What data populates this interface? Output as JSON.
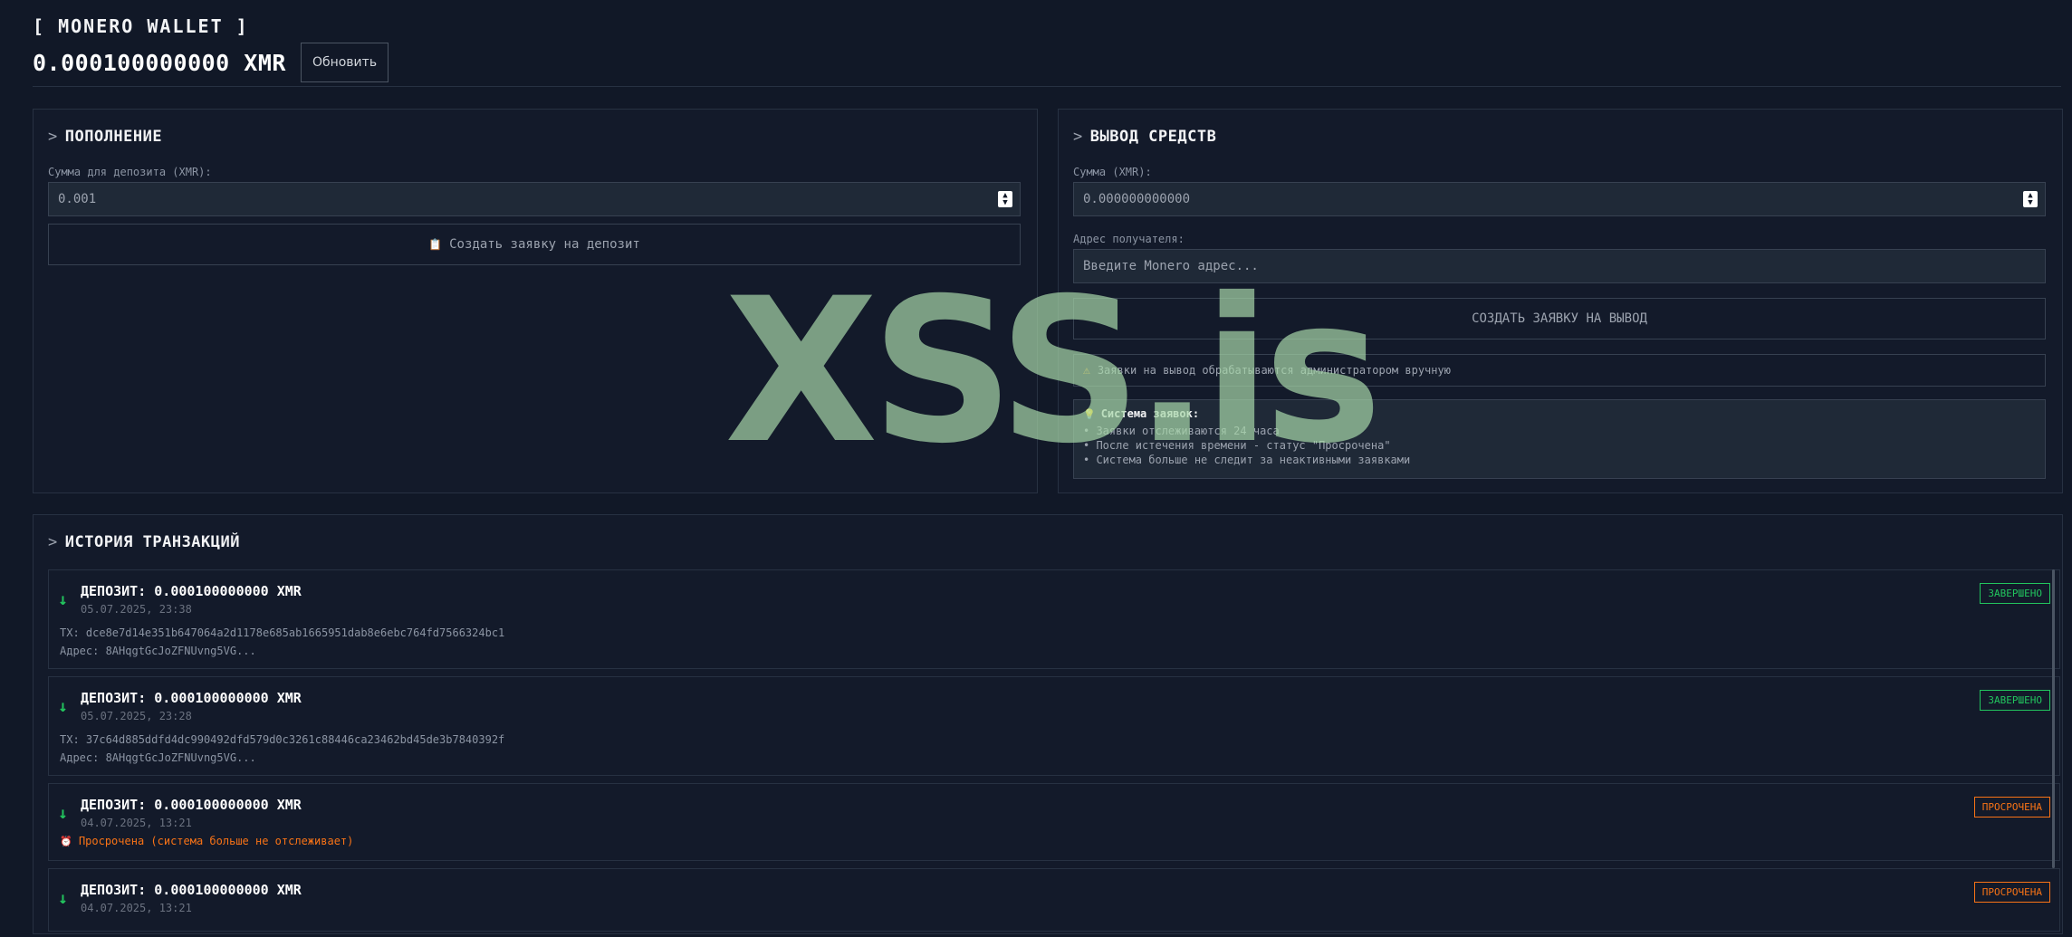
{
  "header": {
    "brand": "[ MONERO WALLET ]",
    "balance": "0.000100000000 XMR",
    "refresh_label": "Обновить"
  },
  "deposit": {
    "title": "ПОПОЛНЕНИЕ",
    "prompt": ">",
    "amount_label": "Сумма для депозита (XMR):",
    "amount_value": "0.001",
    "create_button": "Создать заявку на депозит"
  },
  "withdraw": {
    "title": "ВЫВОД СРЕДСТВ",
    "prompt": ">",
    "amount_label": "Сумма (XMR):",
    "amount_value": "0.000000000000",
    "address_label": "Адрес получателя:",
    "address_placeholder": "Введите Monero адрес...",
    "create_button": "СОЗДАТЬ ЗАЯВКУ НА ВЫВОД",
    "warning": "Заявки на вывод обрабатываются администратором вручную",
    "info_title": "Система заявок:",
    "info_lines": [
      "• Заявки отслеживаются 24 часа",
      "• После истечения времени - статус \"Просрочена\"",
      "• Система больше не следит за неактивными заявками"
    ]
  },
  "history": {
    "title": "ИСТОРИЯ ТРАНЗАКЦИЙ",
    "prompt": ">",
    "transactions": [
      {
        "title": "ДЕПОЗИТ: 0.000100000000 XMR",
        "date": "05.07.2025, 23:38",
        "tx": "TX: dce8e7d14e351b647064a2d1178e685ab1665951dab8e6ebc764fd7566324bc1",
        "address": "Адрес: 8AHqgtGcJoZFNUvng5VG...",
        "status": "ЗАВЕРШЕНО"
      },
      {
        "title": "ДЕПОЗИТ: 0.000100000000 XMR",
        "date": "05.07.2025, 23:28",
        "tx": "TX: 37c64d885ddfd4dc990492dfd579d0c3261c88446ca23462bd45de3b7840392f",
        "address": "Адрес: 8AHqgtGcJoZFNUvng5VG...",
        "status": "ЗАВЕРШЕНО"
      },
      {
        "title": "ДЕПОЗИТ: 0.000100000000 XMR",
        "date": "04.07.2025, 13:21",
        "expired_note": "Просрочена (система больше не отслеживает)",
        "status": "ПРОСРОЧЕНА"
      },
      {
        "title": "ДЕПОЗИТ: 0.000100000000 XMR",
        "date": "04.07.2025, 13:21",
        "status": "ПРОСРОЧЕНА"
      }
    ]
  },
  "watermark": "XSS.is",
  "icons": {
    "arrow_down": "↓",
    "clipboard": "📋",
    "warning": "⚠",
    "bulb": "💡",
    "alarm": "⏰"
  },
  "colors": {
    "background": "#111827",
    "panel": "#131a2a",
    "success": "#22c55e",
    "warning": "#f97316"
  }
}
